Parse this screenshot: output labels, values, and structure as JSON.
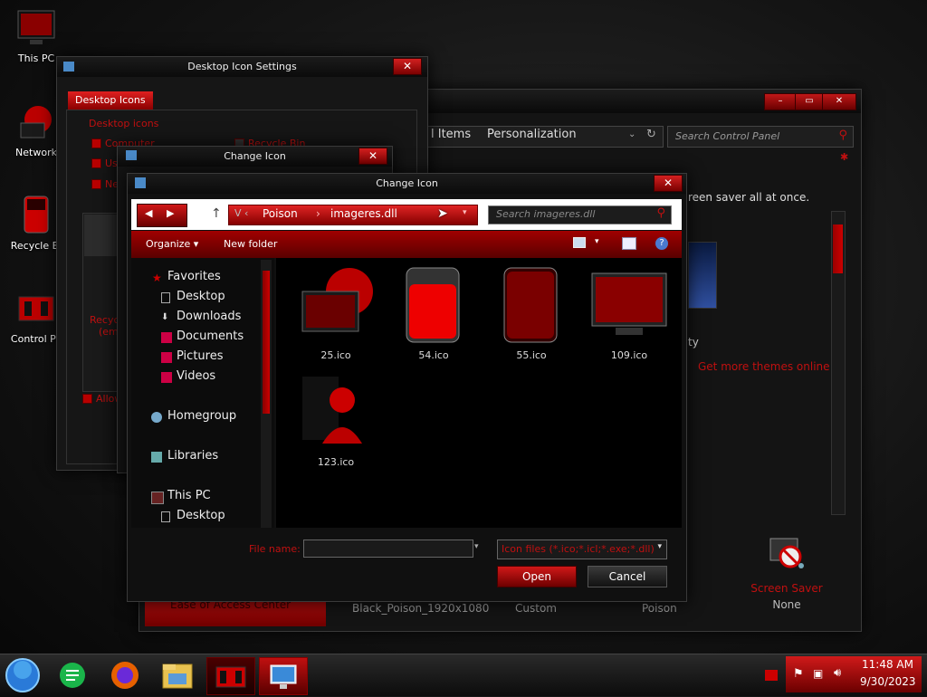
{
  "desktop": {
    "icons": [
      {
        "label": "This PC",
        "icon": "monitor-icon"
      },
      {
        "label": "Network",
        "icon": "network-globe-icon"
      },
      {
        "label": "Recycle Bi",
        "icon": "recycle-bin-icon"
      },
      {
        "label": "Control Pa",
        "icon": "control-panel-icon"
      }
    ]
  },
  "control_panel": {
    "crumbs": [
      "l Items",
      "Personalization"
    ],
    "search_placeholder": "Search Control Panel",
    "body_text": "reen saver all at once.",
    "partial_label": "ty",
    "get_more_link": "Get more themes online",
    "themes": [
      "Black_Poison_1920x1080",
      "Custom",
      "Poison"
    ],
    "ease_label": "Ease of Access Center",
    "screen_saver": {
      "label": "Screen Saver",
      "value": "None"
    }
  },
  "icon_settings": {
    "title": "Desktop Icon Settings",
    "tab": "Desktop Icons",
    "group_label": "Desktop icons",
    "checkboxes": [
      "Computer",
      "Us",
      "Ne"
    ],
    "partial_right": "Recycle Bin",
    "recycle_partial": "Recyc",
    "empty_partial": "(em",
    "allow_label": "Allow"
  },
  "change_icon_back": {
    "title": "Change Icon"
  },
  "change_icon": {
    "title": "Change Icon",
    "breadcrumb": [
      "Poison",
      "imageres.dll"
    ],
    "search_placeholder": "Search imageres.dll",
    "toolbar": {
      "organize": "Organize",
      "new_folder": "New folder"
    },
    "nav": {
      "favorites": "Favorites",
      "fav_items": [
        "Desktop",
        "Downloads",
        "Documents",
        "Pictures",
        "Videos"
      ],
      "homegroup": "Homegroup",
      "libraries": "Libraries",
      "this_pc": "This PC",
      "pc_items": [
        "Desktop"
      ]
    },
    "files": [
      {
        "name": "25.ico"
      },
      {
        "name": "54.ico"
      },
      {
        "name": "55.ico"
      },
      {
        "name": "109.ico"
      },
      {
        "name": "123.ico"
      }
    ],
    "file_name_label": "File name:",
    "file_name_value": "",
    "filter": "Icon files (*.ico;*.icl;*.exe;*.dll)",
    "open": "Open",
    "cancel": "Cancel"
  },
  "taskbar": {
    "time": "11:48 AM",
    "date": "9/30/2023"
  },
  "colors": {
    "accent": "#c01010",
    "accent_dark": "#6a0000",
    "bg": "#111111"
  }
}
